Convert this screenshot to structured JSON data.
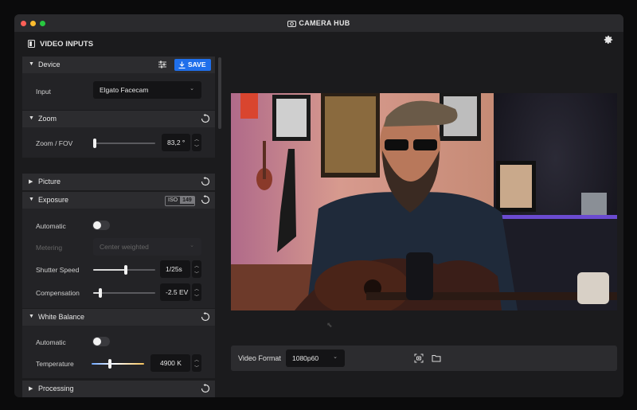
{
  "window": {
    "title": "CAMERA HUB",
    "traffic_lights": [
      "#fe5f57",
      "#febc2e",
      "#28c840"
    ]
  },
  "panel": {
    "title": "VIDEO INPUTS"
  },
  "sections": {
    "device": {
      "label": "Device",
      "save_label": "SAVE",
      "input_label": "Input",
      "input_value": "Elgato Facecam"
    },
    "zoom": {
      "label": "Zoom",
      "fov_label": "Zoom / FOV",
      "fov_value": "83,2 °",
      "fov_level": 0.03
    },
    "picture": {
      "label": "Picture"
    },
    "exposure": {
      "label": "Exposure",
      "iso_label": "ISO",
      "iso_value": "149",
      "automatic_label": "Automatic",
      "automatic_on": false,
      "metering_label": "Metering",
      "metering_value": "Center weighted",
      "shutter_label": "Shutter Speed",
      "shutter_value": "1/25s",
      "shutter_level": 0.52,
      "compensation_label": "Compensation",
      "compensation_value": "-2.5 EV",
      "compensation_level": 0.12
    },
    "white_balance": {
      "label": "White Balance",
      "automatic_label": "Automatic",
      "automatic_on": false,
      "temperature_label": "Temperature",
      "temperature_value": "4900 K",
      "temperature_level": 0.35
    },
    "processing": {
      "label": "Processing"
    }
  },
  "bottom": {
    "video_format_label": "Video Format",
    "video_format_value": "1080p60"
  },
  "colors": {
    "accent": "#1f6feb",
    "background": "#1b1b1d",
    "section_header": "#2c2c2f"
  }
}
